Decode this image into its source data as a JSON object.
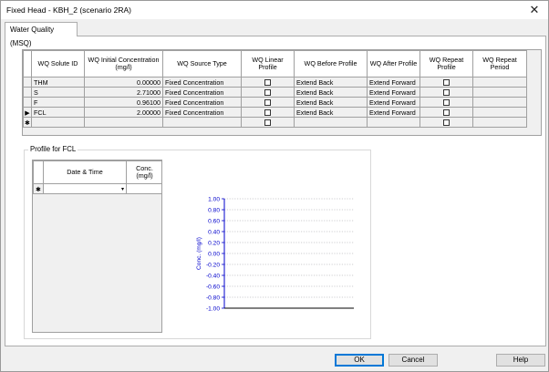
{
  "window": {
    "title": "Fixed Head - KBH_2 (scenario 2RA)",
    "close_glyph": "✕"
  },
  "tabs": [
    {
      "label": "Water Quality (MSQ)",
      "active": true
    }
  ],
  "solute_grid": {
    "columns": [
      "WQ Solute ID",
      "WQ Initial Concentration (mg/l)",
      "WQ Source Type",
      "WQ Linear Profile",
      "WQ Before Profile",
      "WQ After Profile",
      "WQ Repeat Profile",
      "WQ Repeat Period"
    ],
    "rows": [
      {
        "id": "THM",
        "conc": "0.00000",
        "source": "Fixed Concentration",
        "linear": false,
        "before": "Extend Back",
        "after": "Extend Forward",
        "repeat": false,
        "period": "",
        "current": false
      },
      {
        "id": "S",
        "conc": "2.71000",
        "source": "Fixed Concentration",
        "linear": false,
        "before": "Extend Back",
        "after": "Extend Forward",
        "repeat": false,
        "period": "",
        "current": false
      },
      {
        "id": "F",
        "conc": "0.96100",
        "source": "Fixed Concentration",
        "linear": false,
        "before": "Extend Back",
        "after": "Extend Forward",
        "repeat": false,
        "period": "",
        "current": false
      },
      {
        "id": "FCL",
        "conc": "2.00000",
        "source": "Fixed Concentration",
        "linear": false,
        "before": "Extend Back",
        "after": "Extend Forward",
        "repeat": false,
        "period": "",
        "current": true
      }
    ],
    "new_row_marker": "✱",
    "current_row_marker": "▶"
  },
  "profile": {
    "group_title": "Profile for FCL",
    "columns": [
      "Date & Time",
      "Conc. (mg/l)"
    ],
    "new_row_marker": "✱",
    "dropdown_glyph": "▾"
  },
  "chart_data": {
    "type": "line",
    "ylabel": "Conc. (mg/l)",
    "ylim": [
      -1.0,
      1.0
    ],
    "yticks": [
      "1.00",
      "0.80",
      "0.60",
      "0.40",
      "0.20",
      "0.00",
      "-0.20",
      "-0.40",
      "-0.60",
      "-0.80",
      "-1.00"
    ],
    "series": [],
    "grid": true,
    "axis_color": "#0000cc"
  },
  "buttons": {
    "ok": "OK",
    "cancel": "Cancel",
    "help": "Help"
  }
}
